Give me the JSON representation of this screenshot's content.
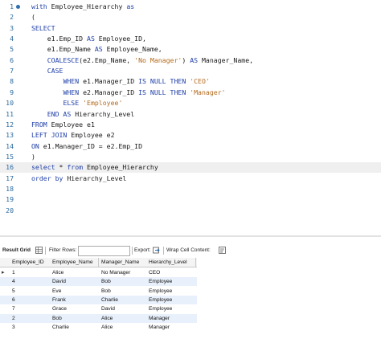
{
  "editor": {
    "line_numbers": [
      "1",
      "2",
      "3",
      "4",
      "5",
      "6",
      "7",
      "8",
      "9",
      "10",
      "11",
      "12",
      "13",
      "14",
      "15",
      "16",
      "17",
      "18",
      "19",
      "20"
    ],
    "lines": [
      [
        {
          "t": "with ",
          "c": "kw"
        },
        {
          "t": "Employee_Hierarchy ",
          "c": ""
        },
        {
          "t": "as",
          "c": "kw"
        }
      ],
      [
        {
          "t": "(",
          "c": ""
        }
      ],
      [
        {
          "t": "SELECT",
          "c": "kw"
        }
      ],
      [
        {
          "t": "    e1.Emp_ID ",
          "c": ""
        },
        {
          "t": "AS",
          "c": "kw"
        },
        {
          "t": " Employee_ID,",
          "c": ""
        }
      ],
      [
        {
          "t": "    e1.Emp_Name ",
          "c": ""
        },
        {
          "t": "AS",
          "c": "kw"
        },
        {
          "t": " Employee_Name,",
          "c": ""
        }
      ],
      [
        {
          "t": "    ",
          "c": ""
        },
        {
          "t": "COALESCE",
          "c": "fn"
        },
        {
          "t": "(e2.Emp_Name, ",
          "c": ""
        },
        {
          "t": "'No Manager'",
          "c": "str"
        },
        {
          "t": ") ",
          "c": ""
        },
        {
          "t": "AS",
          "c": "kw"
        },
        {
          "t": " Manager_Name,",
          "c": ""
        }
      ],
      [
        {
          "t": "    ",
          "c": ""
        },
        {
          "t": "CASE",
          "c": "kw"
        }
      ],
      [
        {
          "t": "        ",
          "c": ""
        },
        {
          "t": "WHEN",
          "c": "kw"
        },
        {
          "t": " e1.Manager_ID ",
          "c": ""
        },
        {
          "t": "IS NULL THEN",
          "c": "kw"
        },
        {
          "t": " ",
          "c": ""
        },
        {
          "t": "'CEO'",
          "c": "str"
        }
      ],
      [
        {
          "t": "        ",
          "c": ""
        },
        {
          "t": "WHEN",
          "c": "kw"
        },
        {
          "t": " e2.Manager_ID ",
          "c": ""
        },
        {
          "t": "IS NULL THEN",
          "c": "kw"
        },
        {
          "t": " ",
          "c": ""
        },
        {
          "t": "'Manager'",
          "c": "str"
        }
      ],
      [
        {
          "t": "        ",
          "c": ""
        },
        {
          "t": "ELSE",
          "c": "kw"
        },
        {
          "t": " ",
          "c": ""
        },
        {
          "t": "'Employee'",
          "c": "str"
        }
      ],
      [
        {
          "t": "    ",
          "c": ""
        },
        {
          "t": "END AS",
          "c": "kw"
        },
        {
          "t": " Hierarchy_Level",
          "c": ""
        }
      ],
      [
        {
          "t": "FROM",
          "c": "kw"
        },
        {
          "t": " Employee e1",
          "c": ""
        }
      ],
      [
        {
          "t": "LEFT JOIN",
          "c": "kw"
        },
        {
          "t": " Employee e2",
          "c": ""
        }
      ],
      [
        {
          "t": "ON",
          "c": "kw"
        },
        {
          "t": " e1.Manager_ID = e2.Emp_ID",
          "c": ""
        }
      ],
      [
        {
          "t": ")",
          "c": ""
        }
      ],
      [
        {
          "t": "select",
          "c": "kw"
        },
        {
          "t": " * ",
          "c": ""
        },
        {
          "t": "from",
          "c": "kw"
        },
        {
          "t": " Employee_Hierarchy",
          "c": ""
        }
      ],
      [
        {
          "t": "order by",
          "c": "kw"
        },
        {
          "t": " Hierarchy_Level",
          "c": ""
        }
      ],
      [],
      [],
      []
    ],
    "highlighted_line": 16
  },
  "toolbar": {
    "result_grid": "Result Grid",
    "filter_rows": "Filter Rows:",
    "filter_value": "",
    "export": "Export:",
    "wrap": "Wrap Cell Content:"
  },
  "grid": {
    "columns": [
      "Employee_ID",
      "Employee_Name",
      "Manager_Name",
      "Hierarchy_Level"
    ],
    "rows": [
      [
        "1",
        "Alice",
        "No Manager",
        "CEO"
      ],
      [
        "4",
        "David",
        "Bob",
        "Employee"
      ],
      [
        "5",
        "Eve",
        "Bob",
        "Employee"
      ],
      [
        "6",
        "Frank",
        "Charlie",
        "Employee"
      ],
      [
        "7",
        "Grace",
        "David",
        "Employee"
      ],
      [
        "2",
        "Bob",
        "Alice",
        "Manager"
      ],
      [
        "3",
        "Charlie",
        "Alice",
        "Manager"
      ]
    ],
    "current_row_marker": "▸"
  },
  "colors": {
    "keyword": "#1f3fa8",
    "string": "#b36a1d",
    "alt_row": "#e8f0fb"
  }
}
